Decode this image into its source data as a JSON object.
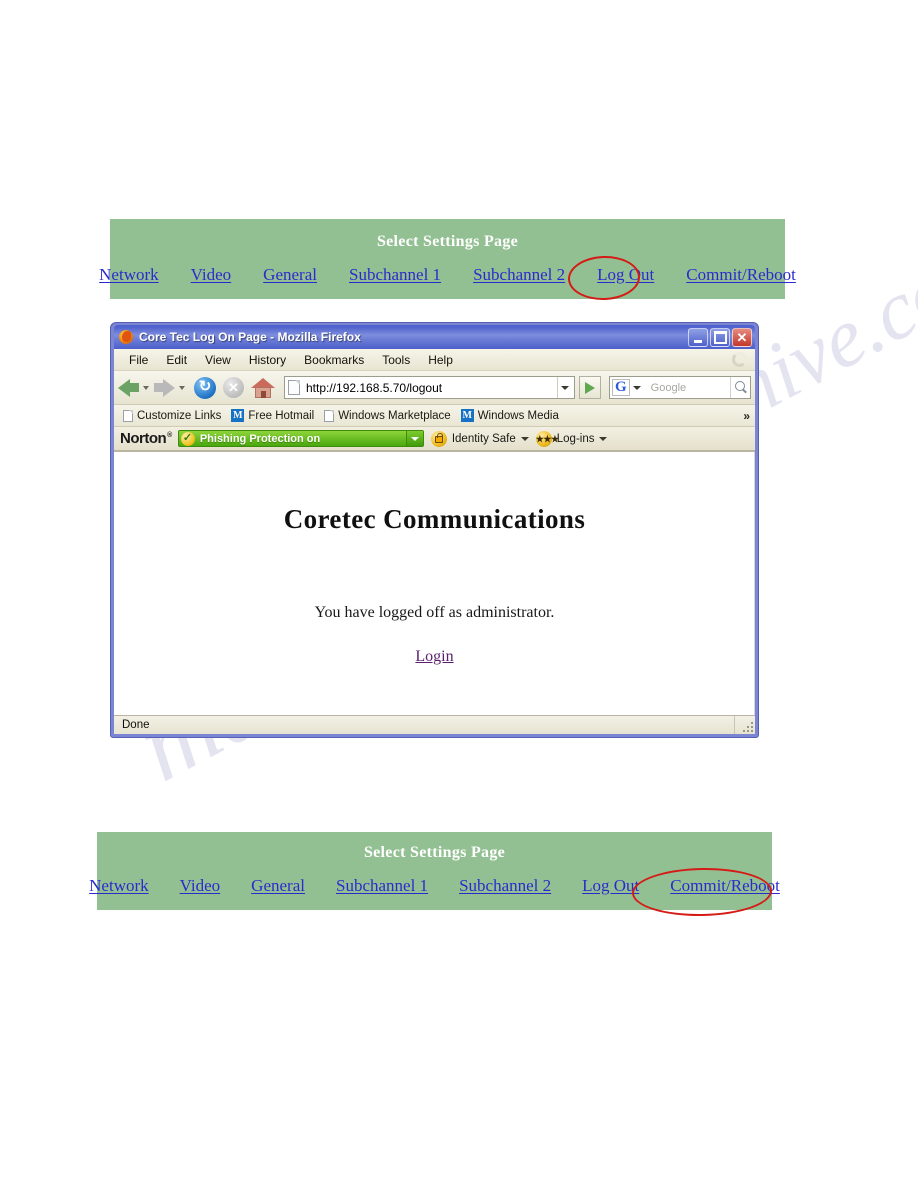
{
  "settings_bar": {
    "title": "Select Settings Page",
    "links": [
      {
        "label": "Network"
      },
      {
        "label": "Video"
      },
      {
        "label": "General"
      },
      {
        "label": "Subchannel 1"
      },
      {
        "label": "Subchannel 2"
      },
      {
        "label": "Log Out"
      },
      {
        "label": "Commit/Reboot"
      }
    ],
    "highlight_top": "Log Out",
    "highlight_bottom": "Commit/Reboot",
    "bar_color": "#93c093",
    "title_color": "#ffffff",
    "link_color": "#2b2bcd",
    "highlight_color": "#d41b16"
  },
  "browser": {
    "title": "Core Tec Log On Page - Mozilla Firefox",
    "window_buttons": {
      "minimize": "minimize-icon",
      "maximize": "maximize-icon",
      "close": "close-icon"
    },
    "menu": [
      {
        "label": "File"
      },
      {
        "label": "Edit"
      },
      {
        "label": "View"
      },
      {
        "label": "History"
      },
      {
        "label": "Bookmarks"
      },
      {
        "label": "Tools"
      },
      {
        "label": "Help"
      }
    ],
    "toolbar": {
      "back": "back-arrow-icon",
      "forward": "forward-arrow-icon",
      "reload": "reload-icon",
      "stop": "stop-icon",
      "home": "home-icon",
      "url": "http://192.168.5.70/logout",
      "go": "go-icon",
      "search_placeholder": "Google",
      "search_engine": "Google",
      "search_icon": "magnifier-icon"
    },
    "bookmarks": [
      {
        "label": "Customize Links",
        "icon": "page-icon"
      },
      {
        "label": "Free Hotmail",
        "icon": "msn-icon"
      },
      {
        "label": "Windows Marketplace",
        "icon": "page-icon"
      },
      {
        "label": "Windows Media",
        "icon": "msn-icon"
      }
    ],
    "bookmarks_overflow": "»",
    "norton": {
      "brand": "Norton",
      "phishing_label": "Phishing Protection on",
      "identity_safe_label": "Identity Safe",
      "logins_label": "Log-ins",
      "pill_color": "#5cb314"
    },
    "page": {
      "heading": "Coretec Communications",
      "message": "You have logged off as administrator.",
      "login_link": "Login"
    },
    "status": "Done"
  },
  "watermark": {
    "line1": "manualshive",
    "line2": "anualshive.com"
  }
}
